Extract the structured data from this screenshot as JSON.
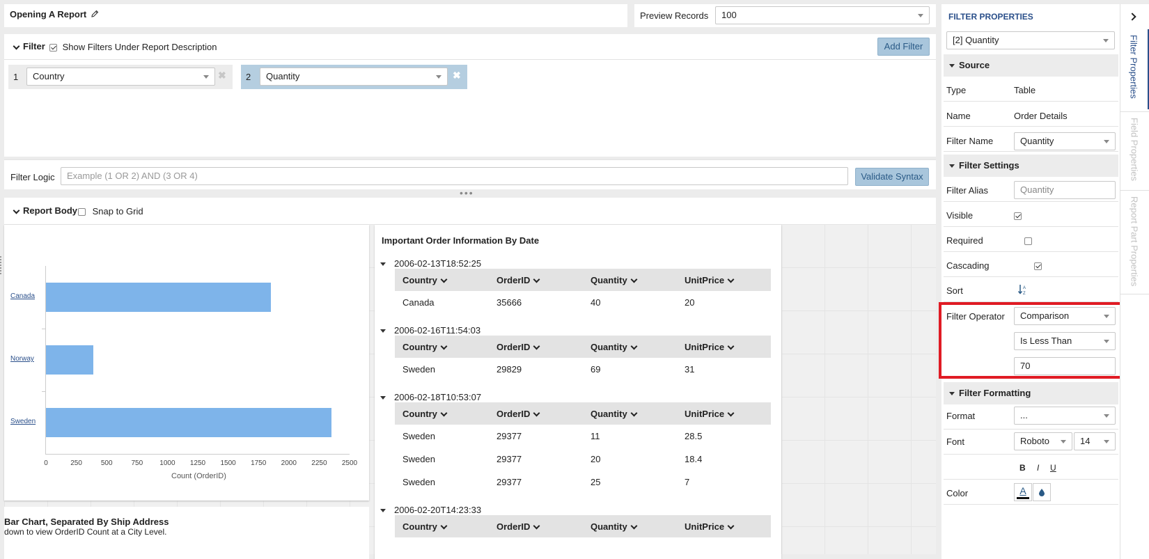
{
  "header": {
    "title": "Opening A Report",
    "preview_label": "Preview Records",
    "preview_value": "100"
  },
  "filter": {
    "title": "Filter",
    "show_under_label": "Show Filters Under Report Description",
    "add_filter_label": "Add Filter",
    "items": [
      {
        "num": "1",
        "field": "Country"
      },
      {
        "num": "2",
        "field": "Quantity"
      }
    ],
    "logic_label": "Filter Logic",
    "logic_placeholder": "Example (1 OR 2) AND (3 OR 4)",
    "validate_label": "Validate Syntax"
  },
  "report_body": {
    "title": "Report Body",
    "snap_label": "Snap to Grid"
  },
  "chart_data": {
    "type": "bar",
    "orientation": "horizontal",
    "categories": [
      "Canada",
      "Norway",
      "Sweden"
    ],
    "values": [
      1850,
      390,
      2350
    ],
    "xlabel": "Count (OrderID)",
    "ylabel": "",
    "xlim": [
      0,
      2500
    ],
    "xticks": [
      "0",
      "250",
      "500",
      "750",
      "1000",
      "1250",
      "1500",
      "1750",
      "2000",
      "2250",
      "2500"
    ]
  },
  "caption": {
    "title": "Bar Chart, Separated By Ship Address",
    "text": "down to view OrderID Count at a City Level."
  },
  "table": {
    "title": "Important Order Information By Date",
    "columns": [
      "Country",
      "OrderID",
      "Quantity",
      "UnitPrice"
    ],
    "groups": [
      {
        "date": "2006-02-13T18:52:25",
        "rows": [
          [
            "Canada",
            "35666",
            "40",
            "20"
          ]
        ]
      },
      {
        "date": "2006-02-16T11:54:03",
        "rows": [
          [
            "Sweden",
            "29829",
            "69",
            "31"
          ]
        ]
      },
      {
        "date": "2006-02-18T10:53:07",
        "rows": [
          [
            "Sweden",
            "29377",
            "11",
            "28.5"
          ],
          [
            "Sweden",
            "29377",
            "20",
            "18.4"
          ],
          [
            "Sweden",
            "29377",
            "25",
            "7"
          ]
        ]
      },
      {
        "date": "2006-02-20T14:23:33",
        "rows": []
      }
    ]
  },
  "props": {
    "title": "FILTER PROPERTIES",
    "selected": "[2] Quantity",
    "source": {
      "title": "Source",
      "type_label": "Type",
      "type_value": "Table",
      "name_label": "Name",
      "name_value": "Order Details",
      "filter_name_label": "Filter Name",
      "filter_name_value": "Quantity"
    },
    "settings": {
      "title": "Filter Settings",
      "alias_label": "Filter Alias",
      "alias_placeholder": "Quantity",
      "visible_label": "Visible",
      "required_label": "Required",
      "cascading_label": "Cascading",
      "sort_label": "Sort",
      "operator_label": "Filter Operator",
      "operator_value": "Comparison",
      "comparison_value": "Is Less Than",
      "operand_value": "70"
    },
    "formatting": {
      "title": "Filter Formatting",
      "format_label": "Format",
      "format_value": "...",
      "font_label": "Font",
      "font_value": "Roboto",
      "size_value": "14",
      "bold": "B",
      "italic": "I",
      "underline": "U",
      "color_label": "Color",
      "color_letter": "A"
    }
  },
  "side_tabs": [
    "Filter Properties",
    "Field Properties",
    "Report Part Properties"
  ],
  "colors": {
    "highlight": "#e01b24",
    "bar": "#7eb4ea",
    "button": "#a9c6dc",
    "accent": "#2a5a86"
  }
}
